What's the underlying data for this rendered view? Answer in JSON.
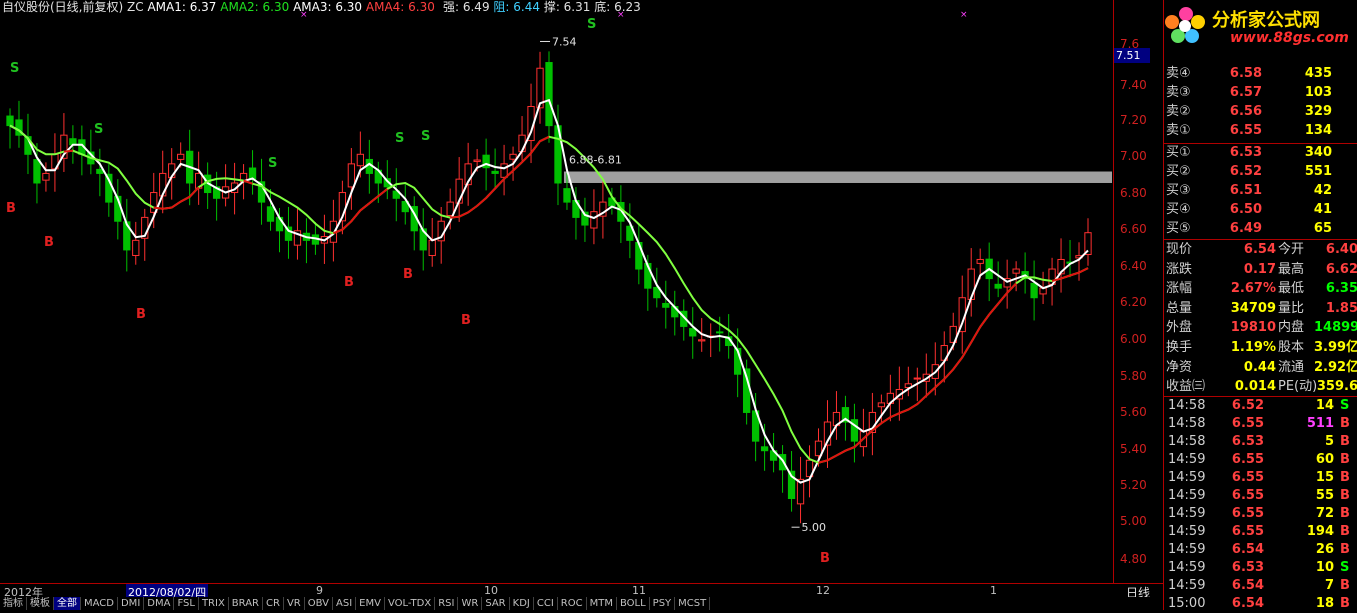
{
  "title": {
    "name": "自仪股份(日线,前复权)",
    "indicator": "ZC",
    "ama1": "AMA1: 6.37",
    "ama2": "AMA2: 6.30",
    "ama3": "AMA3: 6.30",
    "ama4": "AMA4: 6.30",
    "strong": "强: 6.49",
    "resist": "阻: 6.44",
    "support": "撑: 6.31",
    "bottom": "底: 6.23"
  },
  "logo": {
    "text": "分析家公式网",
    "url": "www.88gs.com"
  },
  "price_axis": [
    "7.6",
    "7.40",
    "7.20",
    "7.00",
    "6.80",
    "6.60",
    "6.40",
    "6.20",
    "6.00",
    "5.80",
    "5.60",
    "5.40",
    "5.20",
    "5.00",
    "4.80"
  ],
  "current_price_tag": "7.51",
  "annotations": {
    "high": "7.54",
    "low": "5.00",
    "zone": "6.88-6.81"
  },
  "date_axis": {
    "year": "2012年",
    "cursor_date": "2012/08/02/四",
    "months": [
      "9",
      "10",
      "11",
      "12",
      "1"
    ],
    "period": "日线"
  },
  "tabs": [
    "指标",
    "模板",
    "全部",
    "MACD",
    "DMI",
    "DMA",
    "FSL",
    "TRIX",
    "BRAR",
    "CR",
    "VR",
    "OBV",
    "ASI",
    "EMV",
    "VOL-TDX",
    "RSI",
    "WR",
    "SAR",
    "KDJ",
    "CCI",
    "ROC",
    "MTM",
    "BOLL",
    "PSY",
    "MCST"
  ],
  "order_book": {
    "sell": [
      {
        "label": "卖④",
        "price": "6.58",
        "vol": "435"
      },
      {
        "label": "卖③",
        "price": "6.57",
        "vol": "103"
      },
      {
        "label": "卖②",
        "price": "6.56",
        "vol": "329"
      },
      {
        "label": "卖①",
        "price": "6.55",
        "vol": "134"
      }
    ],
    "buy": [
      {
        "label": "买①",
        "price": "6.53",
        "vol": "340"
      },
      {
        "label": "买②",
        "price": "6.52",
        "vol": "551"
      },
      {
        "label": "买③",
        "price": "6.51",
        "vol": "42"
      },
      {
        "label": "买④",
        "price": "6.50",
        "vol": "41"
      },
      {
        "label": "买⑤",
        "price": "6.49",
        "vol": "65"
      }
    ]
  },
  "quote": [
    {
      "l1": "现价",
      "v1": "6.54",
      "c1": "#ff4040",
      "l2": "今开",
      "v2": "6.40",
      "c2": "#ff4040"
    },
    {
      "l1": "涨跌",
      "v1": "0.17",
      "c1": "#ff4040",
      "l2": "最高",
      "v2": "6.62",
      "c2": "#ff4040"
    },
    {
      "l1": "涨幅",
      "v1": "2.67%",
      "c1": "#ff4040",
      "l2": "最低",
      "v2": "6.35",
      "c2": "#00ff00"
    },
    {
      "l1": "总量",
      "v1": "34709",
      "c1": "#ffff00",
      "l2": "量比",
      "v2": "1.85",
      "c2": "#ff4040"
    },
    {
      "l1": "外盘",
      "v1": "19810",
      "c1": "#ff4040",
      "l2": "内盘",
      "v2": "14899",
      "c2": "#00ff00"
    },
    {
      "l1": "换手",
      "v1": "1.19%",
      "c1": "#ffff00",
      "l2": "股本",
      "v2": "3.99亿",
      "c2": "#ffff00"
    },
    {
      "l1": "净资",
      "v1": "0.44",
      "c1": "#ffff00",
      "l2": "流通",
      "v2": "2.92亿",
      "c2": "#ffff00"
    },
    {
      "l1": "收益㈢",
      "v1": "0.014",
      "c1": "#ffff00",
      "l2": "PE(动)",
      "v2": "359.6",
      "c2": "#ffff00"
    }
  ],
  "ticks": [
    {
      "time": "14:58",
      "price": "6.52",
      "qty": "14",
      "side": "S"
    },
    {
      "time": "14:58",
      "price": "6.55",
      "qty": "511",
      "side": "B"
    },
    {
      "time": "14:58",
      "price": "6.53",
      "qty": "5",
      "side": "B"
    },
    {
      "time": "14:59",
      "price": "6.55",
      "qty": "60",
      "side": "B"
    },
    {
      "time": "14:59",
      "price": "6.55",
      "qty": "15",
      "side": "B"
    },
    {
      "time": "14:59",
      "price": "6.55",
      "qty": "55",
      "side": "B"
    },
    {
      "time": "14:59",
      "price": "6.55",
      "qty": "72",
      "side": "B"
    },
    {
      "time": "14:59",
      "price": "6.55",
      "qty": "194",
      "side": "B"
    },
    {
      "time": "14:59",
      "price": "6.54",
      "qty": "26",
      "side": "B"
    },
    {
      "time": "14:59",
      "price": "6.53",
      "qty": "10",
      "side": "S"
    },
    {
      "time": "14:59",
      "price": "6.54",
      "qty": "7",
      "side": "B"
    },
    {
      "time": "15:00",
      "price": "6.54",
      "qty": "18",
      "side": "B"
    }
  ],
  "chart_data": {
    "type": "candlestick",
    "ylim": [
      4.75,
      7.6
    ],
    "close_series": [
      7.1,
      7.05,
      6.95,
      6.8,
      6.85,
      6.95,
      7.05,
      7.0,
      6.95,
      6.9,
      6.85,
      6.7,
      6.6,
      6.45,
      6.5,
      6.62,
      6.75,
      6.85,
      6.9,
      6.95,
      6.8,
      6.85,
      6.75,
      6.72,
      6.78,
      6.8,
      6.85,
      6.82,
      6.7,
      6.6,
      6.55,
      6.5,
      6.55,
      6.5,
      6.48,
      6.52,
      6.6,
      6.75,
      6.9,
      6.95,
      6.85,
      6.8,
      6.78,
      6.72,
      6.65,
      6.55,
      6.45,
      6.5,
      6.6,
      6.7,
      6.82,
      6.9,
      6.92,
      6.88,
      6.85,
      6.9,
      6.95,
      7.05,
      7.2,
      7.4,
      7.1,
      6.8,
      6.7,
      6.62,
      6.58,
      6.65,
      6.7,
      6.68,
      6.6,
      6.5,
      6.35,
      6.25,
      6.2,
      6.15,
      6.1,
      6.05,
      6.0,
      5.98,
      6.0,
      6.02,
      5.95,
      5.8,
      5.6,
      5.45,
      5.4,
      5.35,
      5.3,
      5.15,
      5.25,
      5.35,
      5.45,
      5.55,
      5.6,
      5.55,
      5.45,
      5.5,
      5.6,
      5.65,
      5.7,
      5.72,
      5.75,
      5.78,
      5.8,
      5.85,
      5.95,
      6.05,
      6.2,
      6.35,
      6.4,
      6.3,
      6.25,
      6.3,
      6.35,
      6.3,
      6.2,
      6.25,
      6.35,
      6.4,
      6.38,
      6.42,
      6.54
    ],
    "signals": [
      {
        "label": "S",
        "color": "#20c020",
        "idx": 0
      },
      {
        "label": "B",
        "color": "#e02020",
        "idx": 0
      },
      {
        "label": "B",
        "color": "#e02020",
        "idx": 7
      },
      {
        "label": "S",
        "color": "#20c020",
        "idx": 17
      },
      {
        "label": "B",
        "color": "#e02020",
        "idx": 24
      },
      {
        "label": "S",
        "color": "#20c020",
        "idx": 45
      },
      {
        "label": "B",
        "color": "#e02020",
        "idx": 56
      },
      {
        "label": "S",
        "color": "#20c020",
        "idx": 66
      },
      {
        "label": "S",
        "color": "#20c020",
        "idx": 72
      },
      {
        "label": "B",
        "color": "#e02020",
        "idx": 79
      },
      {
        "label": "S",
        "color": "#20c020",
        "idx": 104
      },
      {
        "label": "B",
        "color": "#e02020",
        "idx": 108
      },
      {
        "label": "S",
        "color": "#20c020",
        "idx": 140
      },
      {
        "label": "B",
        "color": "#e02020",
        "idx": 198
      }
    ]
  }
}
